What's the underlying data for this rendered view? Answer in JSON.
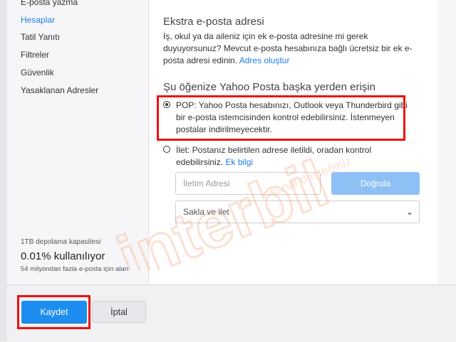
{
  "sidebar": {
    "items": [
      {
        "label": "E-posta yazma"
      },
      {
        "label": "Hesaplar"
      },
      {
        "label": "Tatil Yanıtı"
      },
      {
        "label": "Filtreler"
      },
      {
        "label": "Güvenlik"
      },
      {
        "label": "Yasaklanan Adresler"
      }
    ],
    "active_index": 1,
    "storage": {
      "capacity": "1TB depolama kapasitesi",
      "used": "0.01% kullanılıyor",
      "note": "54 milyondan fazla e-posta için alan"
    }
  },
  "extra_email": {
    "title": "Ekstra e-posta adresi",
    "description": "İş, okul ya da aileniz için ek e-posta adresine mi gerek duyuyorsunuz? Mevcut e-posta hesabınıza bağlı ücretsiz bir ek e-posta adresi edinin.",
    "link": "Adres oluştur"
  },
  "access": {
    "title": "Şu öğenize Yahoo Posta başka yerden erişin",
    "pop_text": "POP: Yahoo Posta hesabınızı, Outlook veya Thunderbird gibi bir e-posta istemcisinden kontrol edebilirsiniz. İstenmeyen postalar indirilmeyecektir.",
    "forward_text": "İlet: Postanız belirtilen adrese iletildi, oradan kontrol edebilirsiniz.",
    "forward_link": "Ek bilgi",
    "address_placeholder": "İletim Adresi",
    "verify_label": "Doğrula",
    "select_value": "Sakla ve ilet"
  },
  "footer": {
    "save_label": "Kaydet",
    "cancel_label": "İptal"
  },
  "watermark": {
    "main": "interbil",
    "sub": "sanal desteğiniz"
  },
  "colors": {
    "accent": "#1d8ef0",
    "link": "#1d7fe6",
    "highlight": "#ee1111",
    "watermark": "#f3a27a"
  }
}
